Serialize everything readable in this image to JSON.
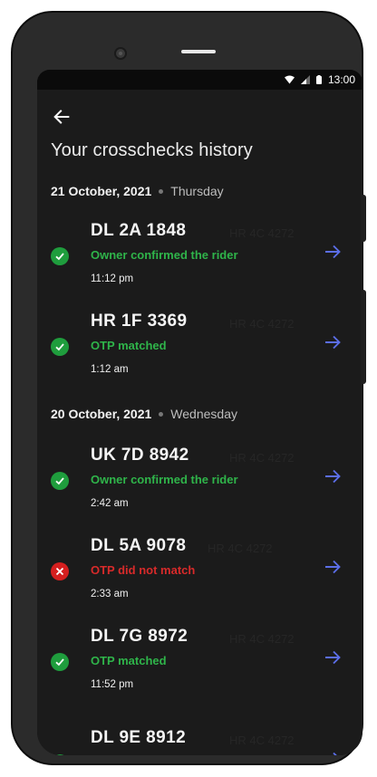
{
  "status_bar": {
    "time": "13:00",
    "icons": [
      "wifi-icon",
      "signal-icon",
      "battery-icon"
    ]
  },
  "header": {
    "back_icon": "arrow-left-icon",
    "title": "Your crosschecks history"
  },
  "groups": [
    {
      "date": "21 October, 2021",
      "weekday": "Thursday",
      "items": [
        {
          "plate": "DL 2A 1848",
          "ghost": "HR 4C 4272",
          "status": "Owner confirmed the rider",
          "status_type": "success",
          "time": "11:12 pm"
        },
        {
          "plate": "HR 1F 3369",
          "ghost": "HR 4C 4272",
          "status": "OTP matched",
          "status_type": "success",
          "time": "1:12 am"
        }
      ]
    },
    {
      "date": "20 October, 2021",
      "weekday": "Wednesday",
      "items": [
        {
          "plate": "UK 7D 8942",
          "ghost": "HR 4C 4272",
          "status": "Owner confirmed the rider",
          "status_type": "success",
          "time": "2:42 am"
        },
        {
          "plate": "DL 5A 9078",
          "ghost": "HR 4C 4272",
          "status": "OTP did not match",
          "status_type": "failure",
          "time": "2:33 am"
        },
        {
          "plate": "DL 7G 8972",
          "ghost": "HR 4C 4272",
          "status": "OTP matched",
          "status_type": "success",
          "time": "11:52 pm"
        },
        {
          "plate": "DL 9E 8912",
          "ghost": "HR 4C 4272",
          "status": "",
          "status_type": "success",
          "time": ""
        }
      ]
    }
  ],
  "colors": {
    "success": "#1f9d3d",
    "failure": "#d51f1f",
    "arrow": "#5b6ee8",
    "background": "#1b1b1b"
  }
}
